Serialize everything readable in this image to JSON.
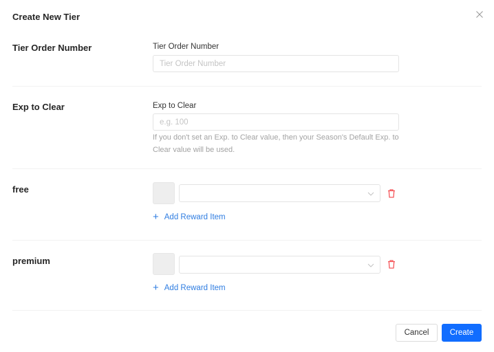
{
  "dialog": {
    "title": "Create New Tier",
    "close_icon": "close-icon"
  },
  "sections": {
    "tier_order": {
      "label": "Tier Order Number",
      "field_label": "Tier Order Number",
      "value": "",
      "placeholder": "Tier Order Number"
    },
    "exp_to_clear": {
      "label": "Exp to Clear",
      "field_label": "Exp to Clear",
      "value": "",
      "placeholder": "e.g. 100",
      "help": "If you don't set an Exp. to Clear value, then your Season's Default Exp. to Clear value will be used."
    },
    "free": {
      "label": "free",
      "reward_select_value": "",
      "add_label": "Add Reward Item"
    },
    "premium": {
      "label": "premium",
      "reward_select_value": "",
      "add_label": "Add Reward Item"
    }
  },
  "footer": {
    "cancel_label": "Cancel",
    "create_label": "Create"
  },
  "colors": {
    "primary": "#116dff",
    "link": "#2f7de1",
    "danger": "#f5565a"
  }
}
